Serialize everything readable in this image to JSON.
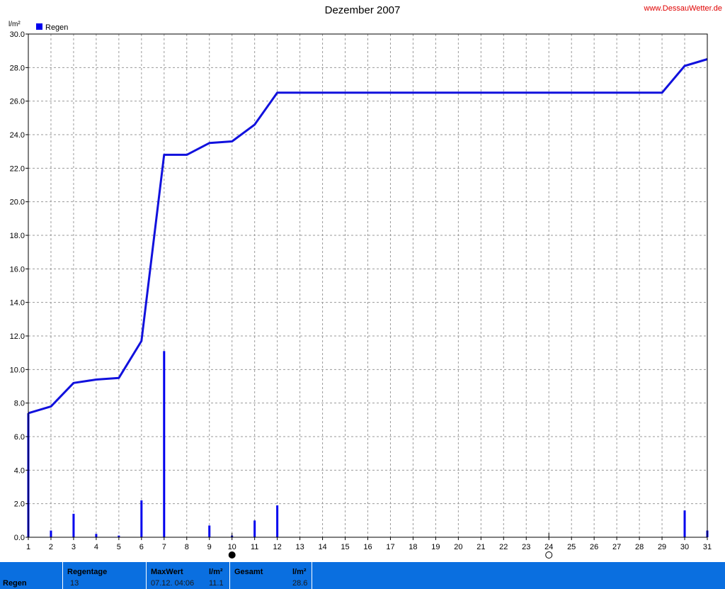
{
  "header": {
    "title": "Dezember 2007",
    "site": "www.DessauWetter.de"
  },
  "chart_data": {
    "type": "bar+line",
    "ylabel": "l/m²",
    "ylim": [
      0,
      30
    ],
    "yticks": [
      "0.0",
      "2.0",
      "4.0",
      "6.0",
      "8.0",
      "10.0",
      "12.0",
      "14.0",
      "16.0",
      "18.0",
      "20.0",
      "22.0",
      "24.0",
      "26.0",
      "28.0",
      "30.0"
    ],
    "xlim": [
      1,
      31
    ],
    "categories": [
      "1",
      "2",
      "3",
      "4",
      "5",
      "6",
      "7",
      "8",
      "9",
      "10",
      "11",
      "12",
      "13",
      "14",
      "15",
      "16",
      "17",
      "18",
      "19",
      "20",
      "21",
      "22",
      "23",
      "24",
      "25",
      "26",
      "27",
      "28",
      "29",
      "30",
      "31"
    ],
    "legend": {
      "name": "Regen",
      "color": "#0000ee",
      "placement": "top-left"
    },
    "grid": true,
    "bars": [
      {
        "x": 1,
        "value": 7.4
      },
      {
        "x": 2,
        "value": 0.4
      },
      {
        "x": 3,
        "value": 1.4
      },
      {
        "x": 4,
        "value": 0.2
      },
      {
        "x": 5,
        "value": 0.1
      },
      {
        "x": 6,
        "value": 2.2
      },
      {
        "x": 7,
        "value": 11.1
      },
      {
        "x": 9,
        "value": 0.7
      },
      {
        "x": 10,
        "value": 0.1
      },
      {
        "x": 11,
        "value": 1.0
      },
      {
        "x": 12,
        "value": 1.9
      },
      {
        "x": 30,
        "value": 1.6
      },
      {
        "x": 31,
        "value": 0.4
      }
    ],
    "cumulative": [
      {
        "x": 1,
        "y": 7.4
      },
      {
        "x": 2,
        "y": 7.8
      },
      {
        "x": 3,
        "y": 9.2
      },
      {
        "x": 4,
        "y": 9.4
      },
      {
        "x": 5,
        "y": 9.5
      },
      {
        "x": 6,
        "y": 11.7
      },
      {
        "x": 7,
        "y": 22.8
      },
      {
        "x": 8,
        "y": 22.8
      },
      {
        "x": 9,
        "y": 23.5
      },
      {
        "x": 10,
        "y": 23.6
      },
      {
        "x": 11,
        "y": 24.6
      },
      {
        "x": 12,
        "y": 26.5
      },
      {
        "x": 29,
        "y": 26.5
      },
      {
        "x": 30,
        "y": 28.1
      },
      {
        "x": 31,
        "y": 28.5
      }
    ],
    "moon_phases": [
      {
        "x": 10,
        "phase": "new-moon-icon"
      },
      {
        "x": 24,
        "phase": "full-moon-icon"
      }
    ],
    "line_color": "#1111dd",
    "bar_color": "#0000ee"
  },
  "footer": {
    "row_label": "Regen",
    "regentage_label": "Regentage",
    "regentage_value": "13",
    "maxwert_label": "MaxWert",
    "maxwert_unit": "l/m²",
    "maxwert_date": "07.12.  04:06",
    "maxwert_value": "11.1",
    "gesamt_label": "Gesamt",
    "gesamt_unit": "l/m²",
    "gesamt_value": "28.6"
  }
}
